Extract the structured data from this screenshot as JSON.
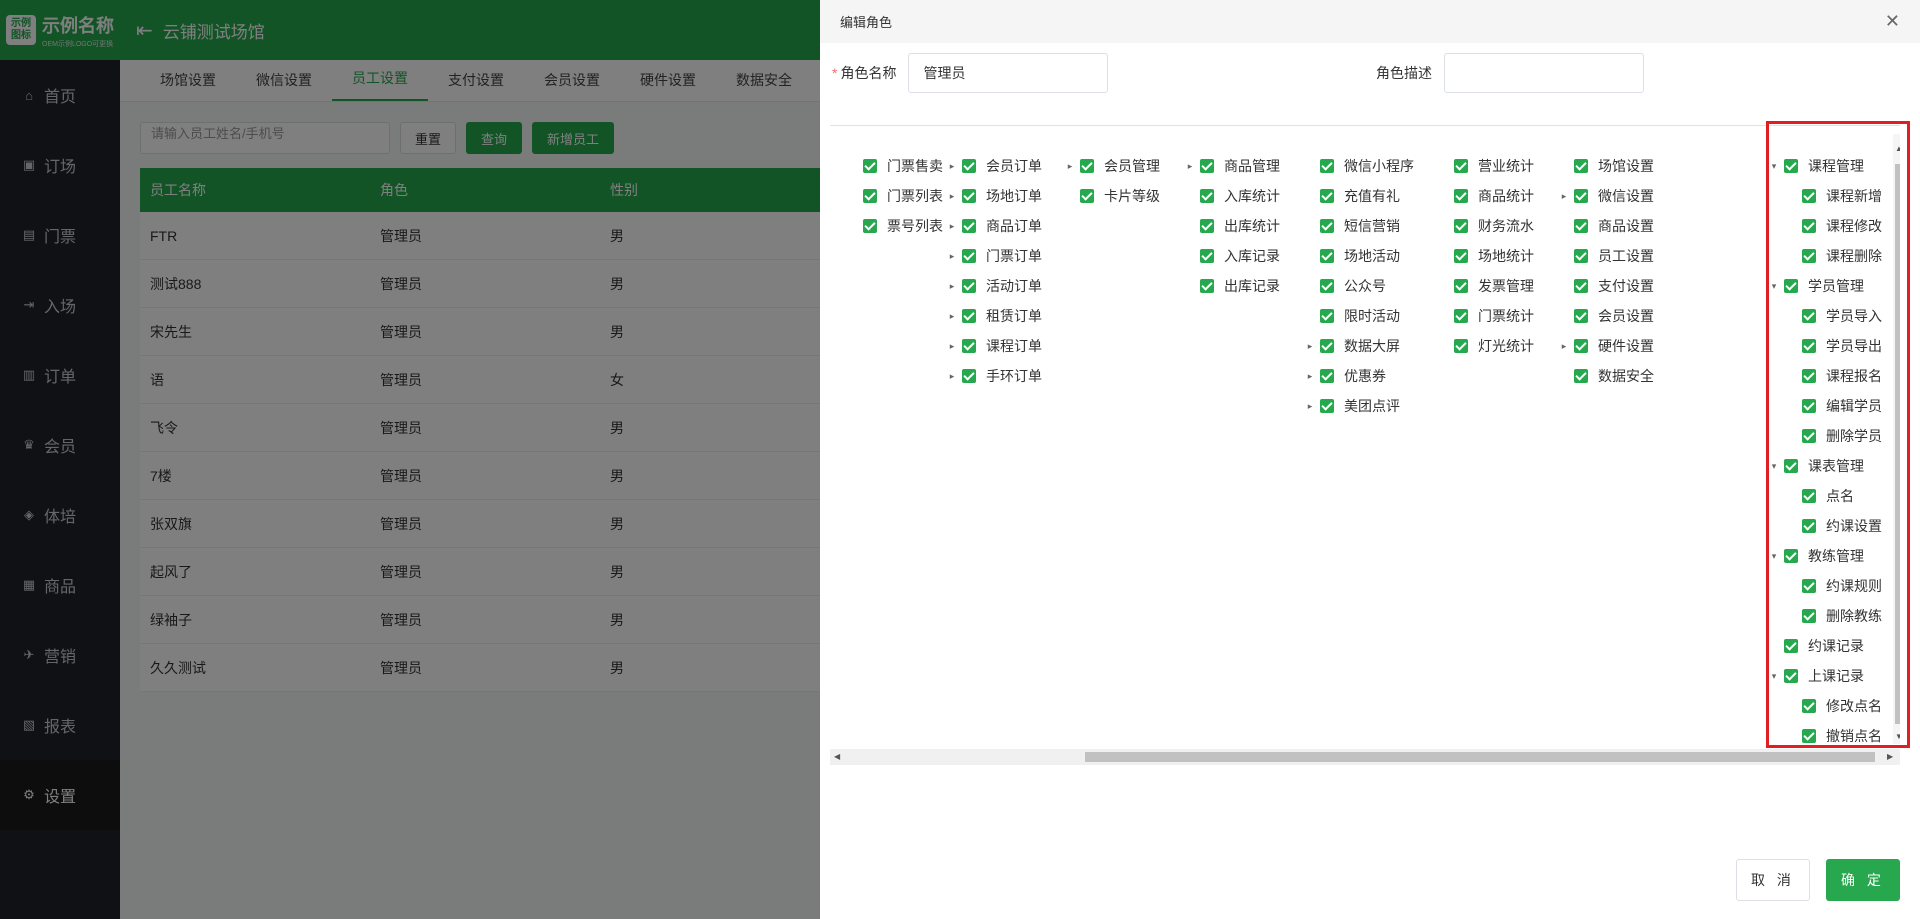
{
  "app": {
    "logo_mark": "示例\n图标",
    "logo_name": "示例名称",
    "logo_sub": "OEM示例LOGO可更换",
    "venue_title": "云铺测试场馆"
  },
  "sidebar": {
    "items": [
      {
        "label": "首页",
        "icon": "home-icon"
      },
      {
        "label": "订场",
        "icon": "court-icon"
      },
      {
        "label": "门票",
        "icon": "ticket-icon"
      },
      {
        "label": "入场",
        "icon": "enter-icon"
      },
      {
        "label": "订单",
        "icon": "order-icon"
      },
      {
        "label": "会员",
        "icon": "member-icon"
      },
      {
        "label": "体培",
        "icon": "training-icon"
      },
      {
        "label": "商品",
        "icon": "goods-icon"
      },
      {
        "label": "营销",
        "icon": "marketing-icon"
      },
      {
        "label": "报表",
        "icon": "report-icon"
      },
      {
        "label": "设置",
        "icon": "gear-icon"
      }
    ],
    "active": "设置"
  },
  "tabs": [
    "场馆设置",
    "微信设置",
    "员工设置",
    "支付设置",
    "会员设置",
    "硬件设置",
    "数据安全"
  ],
  "active_tab": "员工设置",
  "toolbar": {
    "search_placeholder": "请输入员工姓名/手机号",
    "reset": "重置",
    "query": "查询",
    "add": "新增员工"
  },
  "table": {
    "headers": [
      "员工名称",
      "角色",
      "性别"
    ],
    "rows": [
      [
        "FTR",
        "管理员",
        "男"
      ],
      [
        "测试888",
        "管理员",
        "男"
      ],
      [
        "宋先生",
        "管理员",
        "男"
      ],
      [
        "语",
        "管理员",
        "女"
      ],
      [
        "飞令",
        "管理员",
        "男"
      ],
      [
        "7楼",
        "管理员",
        "男"
      ],
      [
        "张双旗",
        "管理员",
        "男"
      ],
      [
        "起风了",
        "管理员",
        "男"
      ],
      [
        "绿袖子",
        "管理员",
        "男"
      ],
      [
        "久久测试",
        "管理员",
        "男"
      ]
    ]
  },
  "drawer": {
    "title": "编辑角色",
    "name_label": "角色名称",
    "name_value": "管理员",
    "desc_label": "角色描述",
    "desc_value": "",
    "cancel": "取 消",
    "ok": "确 定"
  },
  "permission_tree": [
    {
      "children": [
        {
          "label": "门票售卖",
          "expandable": false
        },
        {
          "label": "门票列表",
          "expandable": false
        },
        {
          "label": "票号列表",
          "expandable": false
        }
      ]
    },
    {
      "children": [
        {
          "label": "会员订单",
          "expandable": true
        },
        {
          "label": "场地订单",
          "expandable": true
        },
        {
          "label": "商品订单",
          "expandable": true
        },
        {
          "label": "门票订单",
          "expandable": true
        },
        {
          "label": "活动订单",
          "expandable": true
        },
        {
          "label": "租赁订单",
          "expandable": true
        },
        {
          "label": "课程订单",
          "expandable": true
        },
        {
          "label": "手环订单",
          "expandable": true
        }
      ]
    },
    {
      "children": [
        {
          "label": "会员管理",
          "expandable": true
        },
        {
          "label": "卡片等级",
          "expandable": false
        }
      ]
    },
    {
      "children": [
        {
          "label": "商品管理",
          "expandable": true
        },
        {
          "label": "入库统计",
          "expandable": false
        },
        {
          "label": "出库统计",
          "expandable": false
        },
        {
          "label": "入库记录",
          "expandable": false
        },
        {
          "label": "出库记录",
          "expandable": false
        }
      ]
    },
    {
      "children": [
        {
          "label": "微信小程序",
          "expandable": false
        },
        {
          "label": "充值有礼",
          "expandable": false
        },
        {
          "label": "短信营销",
          "expandable": false
        },
        {
          "label": "场地活动",
          "expandable": false
        },
        {
          "label": "公众号",
          "expandable": false
        },
        {
          "label": "限时活动",
          "expandable": false
        },
        {
          "label": "数据大屏",
          "expandable": true
        },
        {
          "label": "优惠券",
          "expandable": true
        },
        {
          "label": "美团点评",
          "expandable": true
        }
      ]
    },
    {
      "children": [
        {
          "label": "营业统计",
          "expandable": false
        },
        {
          "label": "商品统计",
          "expandable": false
        },
        {
          "label": "财务流水",
          "expandable": false
        },
        {
          "label": "场地统计",
          "expandable": false
        },
        {
          "label": "发票管理",
          "expandable": false
        },
        {
          "label": "门票统计",
          "expandable": false
        },
        {
          "label": "灯光统计",
          "expandable": false
        }
      ]
    },
    {
      "children": [
        {
          "label": "场馆设置",
          "expandable": false
        },
        {
          "label": "微信设置",
          "expandable": true
        },
        {
          "label": "商品设置",
          "expandable": false
        },
        {
          "label": "员工设置",
          "expandable": false
        },
        {
          "label": "支付设置",
          "expandable": false
        },
        {
          "label": "会员设置",
          "expandable": false
        },
        {
          "label": "硬件设置",
          "expandable": true
        },
        {
          "label": "数据安全",
          "expandable": false
        }
      ]
    }
  ],
  "training_tree": [
    {
      "label": "课程管理",
      "level": 1,
      "expanded": true
    },
    {
      "label": "课程新增",
      "level": 2
    },
    {
      "label": "课程修改",
      "level": 2
    },
    {
      "label": "课程删除",
      "level": 2
    },
    {
      "label": "学员管理",
      "level": 1,
      "expanded": true
    },
    {
      "label": "学员导入",
      "level": 2
    },
    {
      "label": "学员导出",
      "level": 2
    },
    {
      "label": "课程报名",
      "level": 2
    },
    {
      "label": "编辑学员",
      "level": 2
    },
    {
      "label": "删除学员",
      "level": 2
    },
    {
      "label": "课表管理",
      "level": 1,
      "expanded": true
    },
    {
      "label": "点名",
      "level": 2
    },
    {
      "label": "约课设置",
      "level": 2
    },
    {
      "label": "教练管理",
      "level": 1,
      "expanded": true
    },
    {
      "label": "约课规则",
      "level": 2
    },
    {
      "label": "删除教练",
      "level": 2
    },
    {
      "label": "约课记录",
      "level": 1,
      "expanded": false
    },
    {
      "label": "上课记录",
      "level": 1,
      "expanded": true
    },
    {
      "label": "修改点名",
      "level": 2
    },
    {
      "label": "撤销点名",
      "level": 2
    }
  ],
  "colors": {
    "accent": "#27a84f",
    "highlight": "#e02020"
  }
}
